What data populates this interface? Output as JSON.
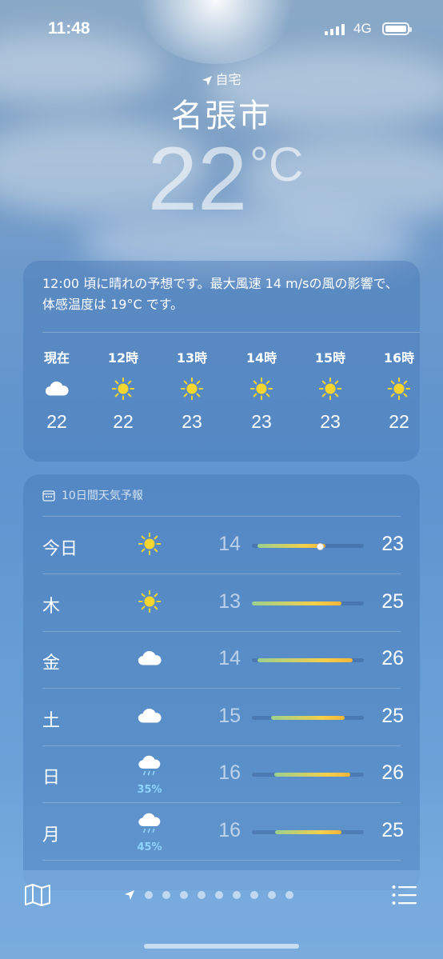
{
  "status_bar": {
    "time": "11:48",
    "network": "4G"
  },
  "location": {
    "label": "自宅",
    "city": "名張市",
    "temperature": "22",
    "unit": "°C"
  },
  "hourly": {
    "summary": "12:00 頃に晴れの予想です。最大風速 14 m/sの風の影響で、体感温度は 19°C です。",
    "items": [
      {
        "label": "現在",
        "icon": "cloud-icon",
        "temp": "22"
      },
      {
        "label": "12時",
        "icon": "sun-icon",
        "temp": "22"
      },
      {
        "label": "13時",
        "icon": "sun-icon",
        "temp": "23"
      },
      {
        "label": "14時",
        "icon": "sun-icon",
        "temp": "23"
      },
      {
        "label": "15時",
        "icon": "sun-icon",
        "temp": "23"
      },
      {
        "label": "16時",
        "icon": "sun-icon",
        "temp": "22"
      }
    ]
  },
  "daily": {
    "header": "10日間天気予報",
    "days": [
      {
        "day": "今日",
        "icon": "sun-icon",
        "low": "14",
        "high": "23",
        "pop": "",
        "bar_start": 0.05,
        "bar_end": 0.66,
        "current_marker": 0.6
      },
      {
        "day": "木",
        "icon": "sun-icon",
        "low": "13",
        "high": "25",
        "pop": "",
        "bar_start": 0.0,
        "bar_end": 0.8
      },
      {
        "day": "金",
        "icon": "cloud-icon",
        "low": "14",
        "high": "26",
        "pop": "",
        "bar_start": 0.05,
        "bar_end": 0.9
      },
      {
        "day": "土",
        "icon": "cloud-icon",
        "low": "15",
        "high": "25",
        "pop": "",
        "bar_start": 0.17,
        "bar_end": 0.83
      },
      {
        "day": "日",
        "icon": "rain-icon",
        "low": "16",
        "high": "26",
        "pop": "35%",
        "bar_start": 0.2,
        "bar_end": 0.88
      },
      {
        "day": "月",
        "icon": "rain-icon",
        "low": "16",
        "high": "25",
        "pop": "45%",
        "bar_start": 0.21,
        "bar_end": 0.8
      }
    ]
  },
  "bottom_bar": {
    "page_dots": 9
  }
}
